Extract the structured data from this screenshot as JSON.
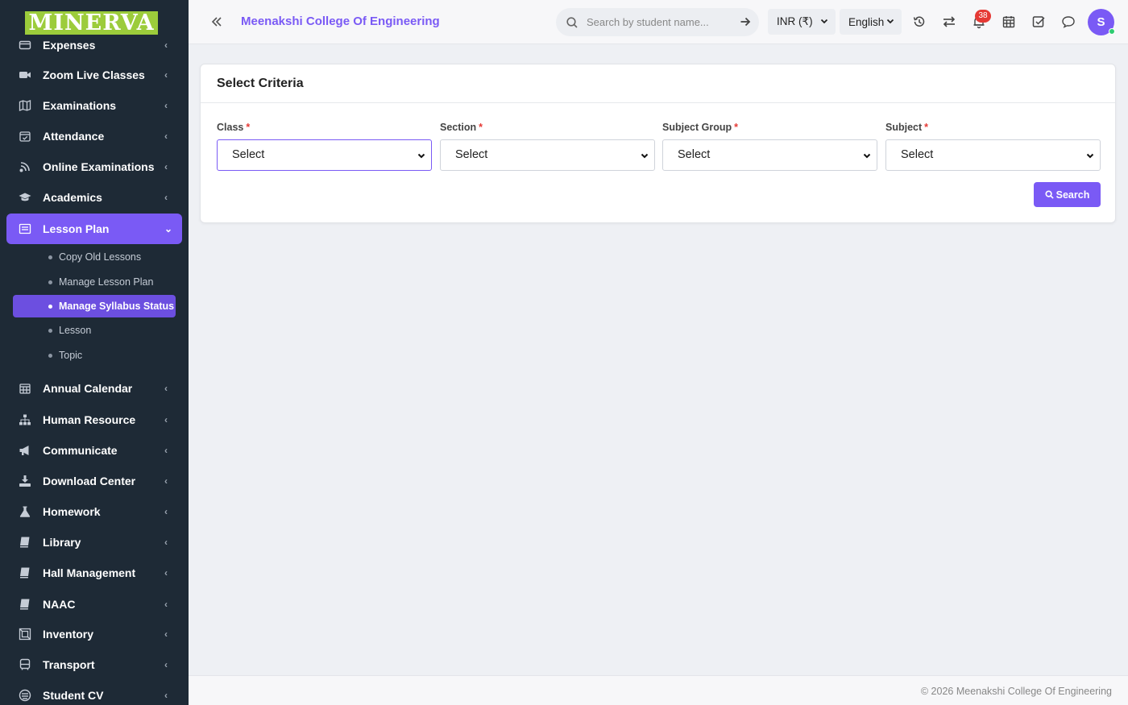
{
  "brand": {
    "logo_text": "MINERVA"
  },
  "header": {
    "college_name": "Meenakshi College Of Engineering",
    "search_placeholder": "Search by student name...",
    "currency": "INR (₹)",
    "language": "English",
    "notification_count": "38",
    "avatar_initial": "S"
  },
  "sidebar": {
    "items": [
      {
        "label": "Expenses",
        "icon": "wallet-icon"
      },
      {
        "label": "Zoom Live Classes",
        "icon": "video-icon"
      },
      {
        "label": "Examinations",
        "icon": "map-icon"
      },
      {
        "label": "Attendance",
        "icon": "calendar-check-icon"
      },
      {
        "label": "Online Examinations",
        "icon": "rss-icon"
      },
      {
        "label": "Academics",
        "icon": "graduation-cap-icon"
      },
      {
        "label": "Lesson Plan",
        "icon": "list-alt-icon"
      },
      {
        "label": "Annual Calendar",
        "icon": "calendar-icon"
      },
      {
        "label": "Human Resource",
        "icon": "sitemap-icon"
      },
      {
        "label": "Communicate",
        "icon": "bullhorn-icon"
      },
      {
        "label": "Download Center",
        "icon": "download-icon"
      },
      {
        "label": "Homework",
        "icon": "flask-icon"
      },
      {
        "label": "Library",
        "icon": "book-icon"
      },
      {
        "label": "Hall Management",
        "icon": "book-icon"
      },
      {
        "label": "NAAC",
        "icon": "book-icon"
      },
      {
        "label": "Inventory",
        "icon": "inventory-icon"
      },
      {
        "label": "Transport",
        "icon": "bus-icon"
      },
      {
        "label": "Student CV",
        "icon": "cv-icon"
      }
    ],
    "lesson_plan_subitems": [
      {
        "label": "Copy Old Lessons"
      },
      {
        "label": "Manage Lesson Plan"
      },
      {
        "label": "Manage Syllabus Status"
      },
      {
        "label": "Lesson"
      },
      {
        "label": "Topic"
      }
    ]
  },
  "criteria": {
    "title": "Select Criteria",
    "required_mark": "*",
    "fields": [
      {
        "label": "Class",
        "value": "Select"
      },
      {
        "label": "Section",
        "value": "Select"
      },
      {
        "label": "Subject Group",
        "value": "Select"
      },
      {
        "label": "Subject",
        "value": "Select"
      }
    ],
    "search_label": "Search"
  },
  "footer": {
    "text": "© 2026 Meenakshi College Of Engineering"
  },
  "colors": {
    "accent": "#7a5af5",
    "sidebar_bg": "#1e2a36",
    "required": "#e53935",
    "logo_bg": "#9ccc3b"
  }
}
